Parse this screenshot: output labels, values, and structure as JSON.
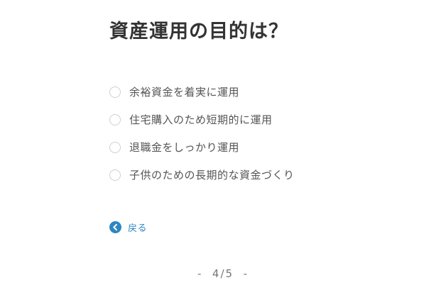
{
  "question": {
    "title": "資産運用の目的は？"
  },
  "options": [
    {
      "label": "余裕資金を着実に運用"
    },
    {
      "label": "住宅購入のため短期的に運用"
    },
    {
      "label": "退職金をしっかり運用"
    },
    {
      "label": "子供のための長期的な資金づくり"
    }
  ],
  "navigation": {
    "back_label": "戻る",
    "back_icon": "chevron-left-circle-icon"
  },
  "pagination": {
    "text": "-  4/5  -"
  },
  "colors": {
    "accent": "#2e86c1",
    "title": "#333333",
    "option_text": "#555555",
    "radio_border": "#cfcfcf"
  }
}
